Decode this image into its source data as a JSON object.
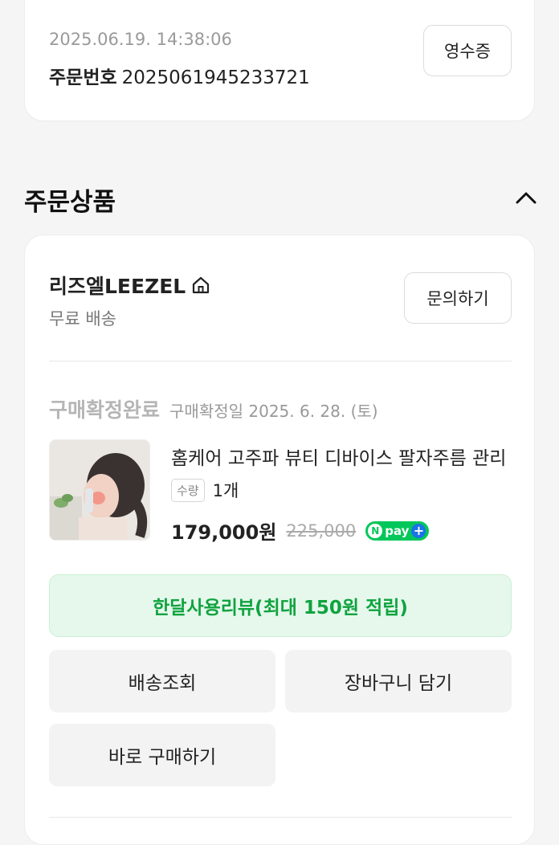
{
  "order": {
    "date": "2025.06.19. 14:38:06",
    "number_label": "주문번호",
    "number": "2025061945233721",
    "receipt_label": "영수증"
  },
  "section": {
    "title": "주문상품"
  },
  "shop": {
    "name": "리즈엘LEEZEL",
    "shipping": "무료 배송",
    "inquiry_label": "문의하기"
  },
  "item": {
    "status": "구매확정완료",
    "confirm_date": "구매확정일 2025. 6. 28. (토)",
    "name": "홈케어 고주파 뷰티 디바이스 팔자주름 관리",
    "qty_label": "수량",
    "qty": "1개",
    "price": "179,000원",
    "original_price": "225,000",
    "npay_n": "N",
    "npay_text": "pay",
    "npay_plus": "+"
  },
  "actions": {
    "review": "한달사용리뷰(최대 150원 적립)",
    "track_shipping": "배송조회",
    "add_to_cart": "장바구니 담기",
    "buy_now": "바로 구매하기"
  },
  "colors": {
    "accent_green": "#10a33f",
    "npay_green": "#03c75a"
  }
}
